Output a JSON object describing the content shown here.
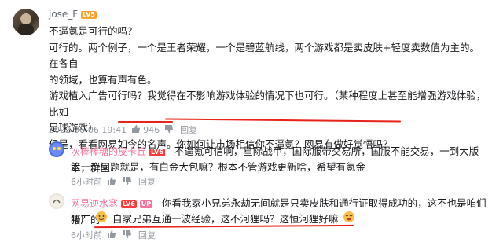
{
  "main_comment": {
    "username": "jose_F",
    "level": "LV5",
    "lines": [
      "不逼氪是可行的吗？",
      "可行的。两个例子，一个是王者荣耀，一个是碧蓝航线，两个游戏都是卖皮肤+轻度卖数值为主的。在各自",
      "的领域，也算有声有色。",
      "游戏植入广告可行吗？我觉得在不影响游戏体验的情况下也可行。（某种程度上甚至能增强游戏体验，比如",
      "足球游戏）",
      "但是，看看网易如今的名声。你如何让市场相信你不逼氪？网易有做好觉悟吗？"
    ],
    "date": "2022-06-06 19:41",
    "likes": "946",
    "reply_label": "回复"
  },
  "reply1": {
    "username": "次棒棒糖的皮卡丘",
    "level": "LV6",
    "line1": "不逼氪可信啊，星际战甲，国际服带交易所，国服不能交易，一到大版本，群里",
    "line2": "第一个问题就是，有白金大包嘛？根本不管游戏更新啥，希望有氪金",
    "time": "6小时前",
    "reply_label": "回复"
  },
  "reply2": {
    "username": "网易逆水寒",
    "level": "LV6",
    "up_label": "UP",
    "line1": "你看我家小兄弟永劫无间就是只卖皮肤和通行证取得成功的，这不也是咱们猪厂的",
    "line2": "吗？",
    "line2b": "自家兄弟互通一波经验，这不河狸吗？这恒河狸好嘛",
    "time": "6小时前",
    "reply_label": "回复"
  },
  "colors": {
    "lv5": "#ff9f2c",
    "lv6": "#ff3b3b",
    "username_pink": "#fb7299",
    "annotation": "#e8231b"
  }
}
